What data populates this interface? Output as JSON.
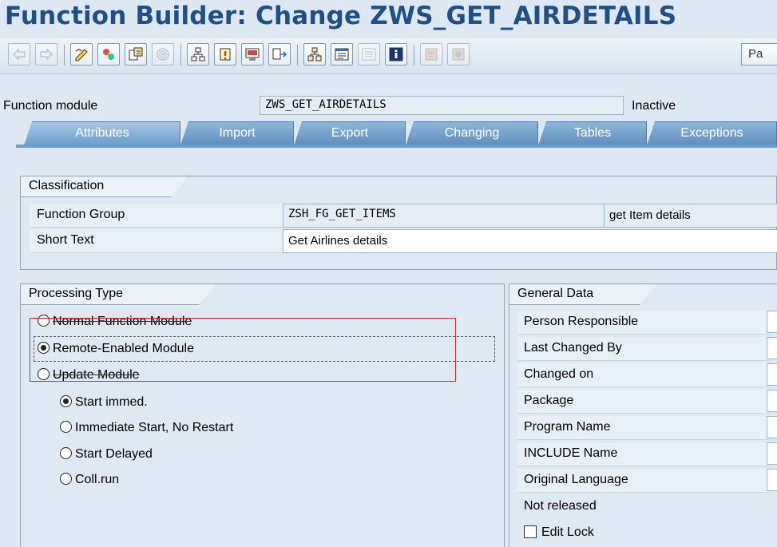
{
  "window": {
    "title": "Function Builder: Change ZWS_GET_AIRDETAILS"
  },
  "toolbar": {
    "buttons": [
      {
        "name": "back-arrow-icon",
        "disabled": true
      },
      {
        "name": "forward-arrow-icon",
        "disabled": true
      },
      {
        "name": "change-display-pencil-icon"
      },
      {
        "name": "active-inactive-icon"
      },
      {
        "name": "other-object-icon"
      },
      {
        "name": "where-used-icon",
        "disabled": true
      },
      {
        "name": "hierarchy-icon"
      },
      {
        "name": "activate-icon"
      },
      {
        "name": "test-icon"
      },
      {
        "name": "where-used-list-icon"
      },
      {
        "name": "display-object-list-icon"
      },
      {
        "name": "navigation-window-icon"
      },
      {
        "name": "inactive-list-icon",
        "disabled": true
      },
      {
        "name": "info-icon"
      },
      {
        "name": "pattern-icon",
        "disabled": true
      },
      {
        "name": "pretty-printer-icon",
        "disabled": true
      }
    ],
    "pa_label": "Pa"
  },
  "header": {
    "function_module_label": "Function module",
    "function_module_value": "ZWS_GET_AIRDETAILS",
    "status": "Inactive"
  },
  "tabs": [
    {
      "label": "Attributes",
      "active": true
    },
    {
      "label": "Import"
    },
    {
      "label": "Export"
    },
    {
      "label": "Changing"
    },
    {
      "label": "Tables"
    },
    {
      "label": "Exceptions"
    }
  ],
  "classification": {
    "title": "Classification",
    "function_group_label": "Function Group",
    "function_group_value": "ZSH_FG_GET_ITEMS",
    "function_group_desc": "get Item details",
    "short_text_label": "Short Text",
    "short_text_value": "Get Airlines details"
  },
  "processing_type": {
    "title": "Processing Type",
    "options": [
      {
        "label": "Normal Function Module",
        "selected": false
      },
      {
        "label": "Remote-Enabled Module",
        "selected": true
      },
      {
        "label": "Update Module",
        "selected": false
      }
    ],
    "update_options": [
      {
        "label": "Start immed.",
        "selected": true
      },
      {
        "label": "Immediate Start, No Restart",
        "selected": false
      },
      {
        "label": "Start Delayed",
        "selected": false
      },
      {
        "label": "Coll.run",
        "selected": false
      }
    ]
  },
  "general_data": {
    "title": "General Data",
    "rows": [
      {
        "label": "Person Responsible"
      },
      {
        "label": "Last Changed By"
      },
      {
        "label": "Changed on"
      },
      {
        "label": "Package"
      },
      {
        "label": "Program Name"
      },
      {
        "label": "INCLUDE Name"
      },
      {
        "label": "Original Language"
      }
    ],
    "not_released": "Not released",
    "edit_lock_label": "Edit Lock"
  },
  "colors": {
    "title": "#1e4f88",
    "highlight": "#e0262b",
    "tab": "#6b9ccc"
  }
}
